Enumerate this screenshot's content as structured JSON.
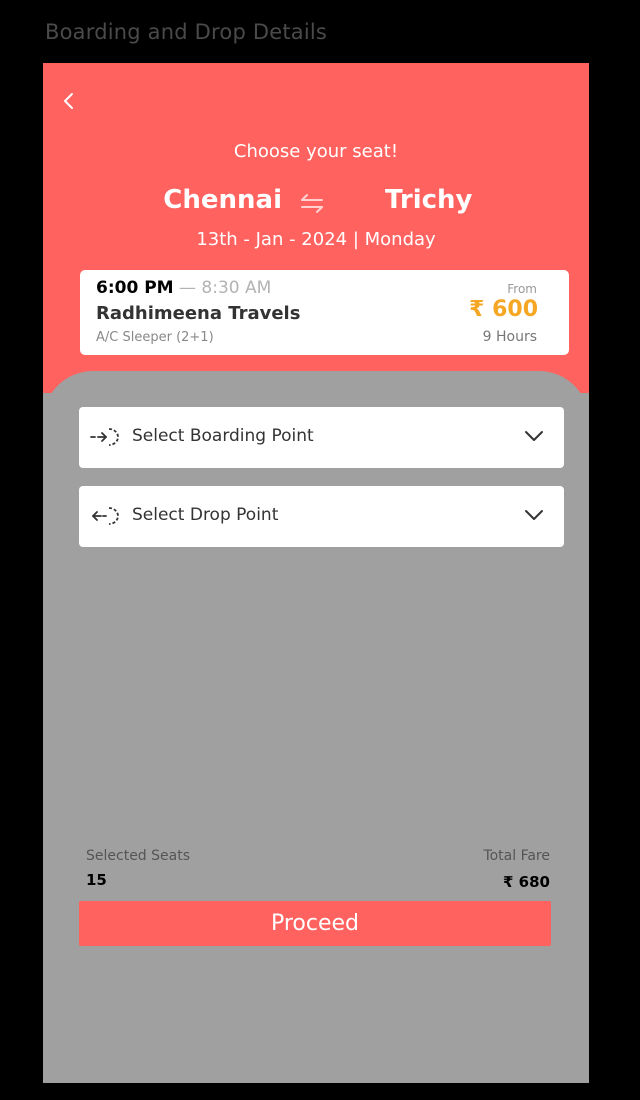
{
  "screen_title": "Boarding and Drop Details",
  "header": {
    "subtitle": "Choose your seat!",
    "from_city": "Chennai",
    "to_city": "Trichy",
    "date_line": "13th - Jan - 2024 | Monday",
    "back_icon": "chevron-left-icon",
    "swap_icon": "swap-arrows-icon"
  },
  "bus": {
    "departure": "6:00 PM",
    "separator": "—",
    "arrival": "8:30 AM",
    "operator": "Radhimeena Travels",
    "type": "A/C Sleeper (2+1)",
    "from_label": "From",
    "price": "₹ 600",
    "duration": "9 Hours"
  },
  "selectors": {
    "boarding": {
      "label": "Select Boarding Point",
      "icon": "boarding-in-icon"
    },
    "drop": {
      "label": "Select Drop Point",
      "icon": "drop-out-icon"
    }
  },
  "summary": {
    "seats_label": "Selected Seats",
    "seats_value": "15",
    "fare_label": "Total Fare",
    "fare_value": "₹ 680"
  },
  "actions": {
    "proceed_label": "Proceed"
  },
  "colors": {
    "accent": "#ff625f",
    "price": "#f5a623",
    "sheet": "#a0a0a0",
    "background": "#000000"
  }
}
